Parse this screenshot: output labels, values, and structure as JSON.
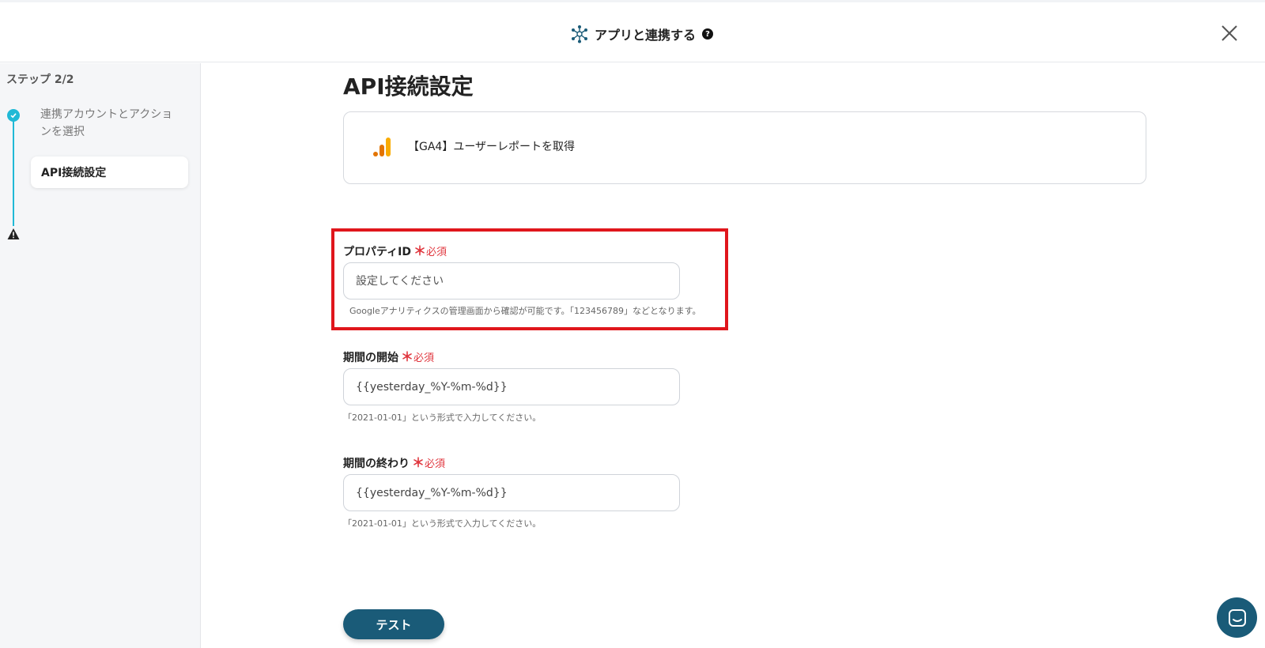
{
  "header": {
    "title": "アプリと連携する",
    "help_glyph": "?"
  },
  "sidebar": {
    "step_count": "ステップ 2/2",
    "steps": [
      {
        "label": "連携アカウントとアクションを選択",
        "status": "done"
      },
      {
        "label": "API接続設定",
        "status": "current-warning"
      }
    ]
  },
  "main": {
    "title": "API接続設定",
    "action": {
      "label": "【GA4】ユーザーレポートを取得",
      "icon": "google-analytics-icon"
    },
    "fields": [
      {
        "label": "プロパティID",
        "required_star": "＊",
        "required_text": "必須",
        "value": "",
        "placeholder": "設定してください",
        "help": "Googleアナリティクスの管理画面から確認が可能です。「123456789」などとなります。"
      },
      {
        "label": "期間の開始",
        "required_star": "＊",
        "required_text": "必須",
        "value": "{{yesterday_%Y-%m-%d}}",
        "placeholder": "",
        "help": "「2021-01-01」という形式で入力してください。"
      },
      {
        "label": "期間の終わり",
        "required_star": "＊",
        "required_text": "必須",
        "value": "{{yesterday_%Y-%m-%d}}",
        "placeholder": "",
        "help": "「2021-01-01」という形式で入力してください。"
      }
    ],
    "test_button": "テスト"
  },
  "colors": {
    "accent": "#1a5b78",
    "step_done": "#20b9d6",
    "required": "#e0363e",
    "highlight": "#e0161c",
    "ga_orange": "#f9ab00",
    "ga_dark_orange": "#e37400"
  }
}
